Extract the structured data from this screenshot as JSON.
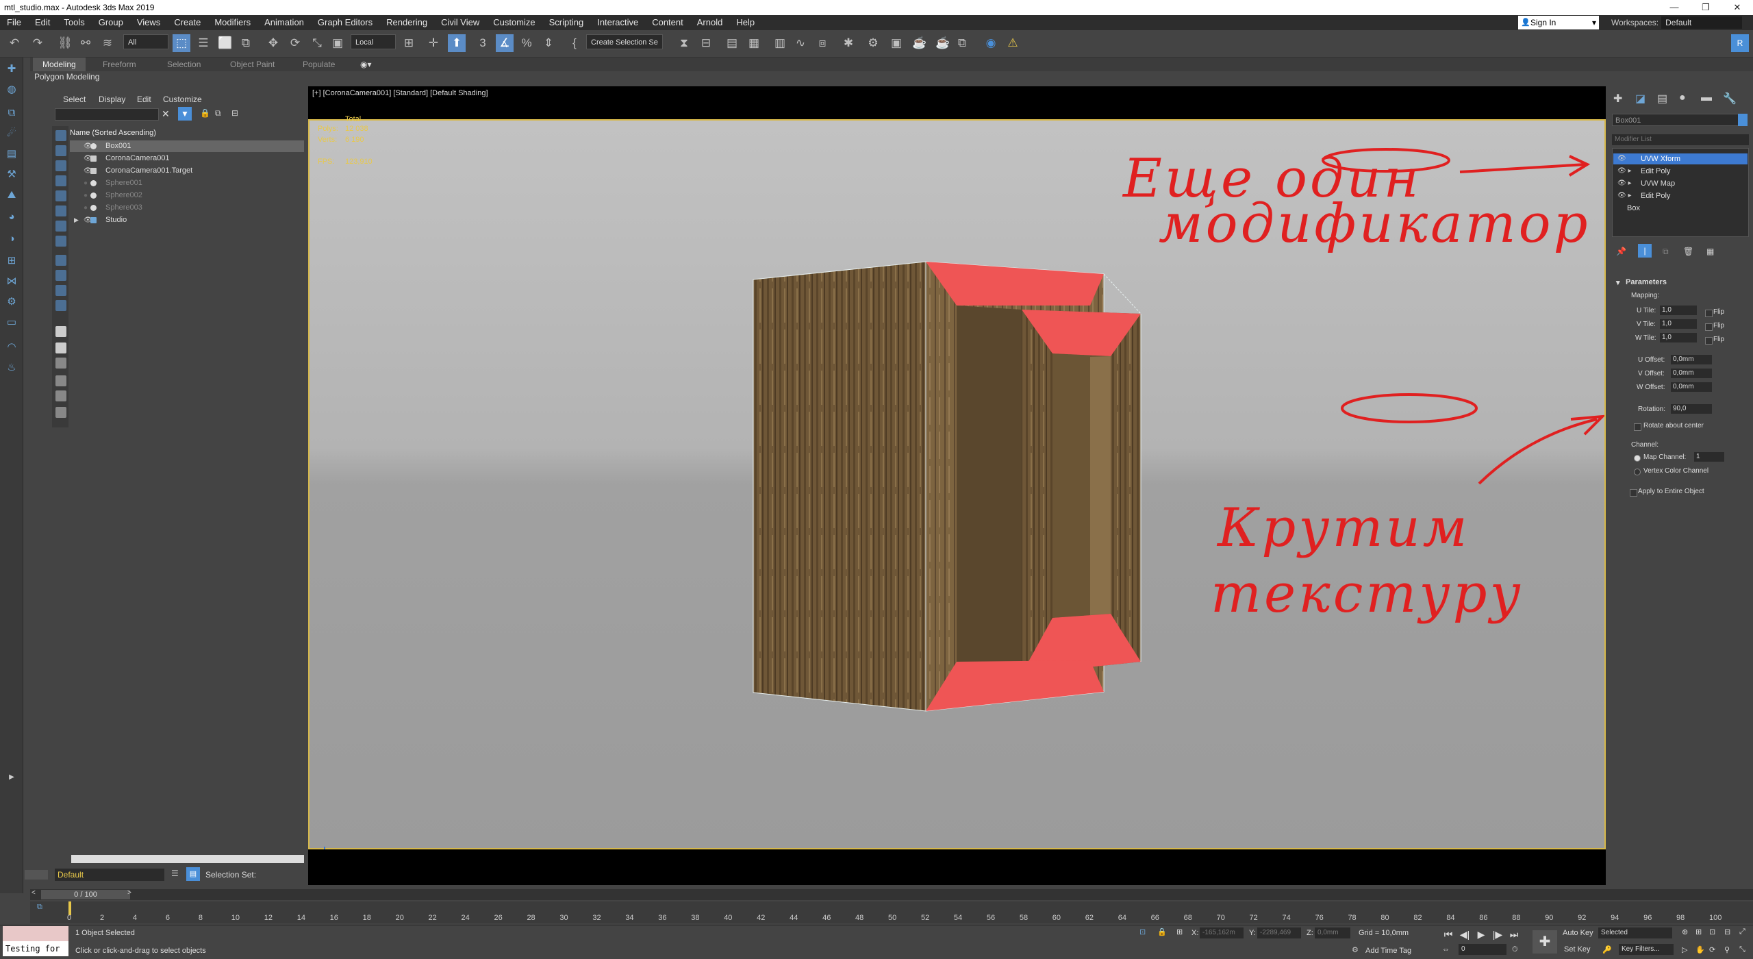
{
  "window": {
    "title": "mtl_studio.max - Autodesk 3ds Max 2019",
    "controls": [
      "—",
      "❐",
      "✕"
    ]
  },
  "menu": [
    "File",
    "Edit",
    "Tools",
    "Group",
    "Views",
    "Create",
    "Modifiers",
    "Animation",
    "Graph Editors",
    "Rendering",
    "Civil View",
    "Customize",
    "Scripting",
    "Interactive",
    "Content",
    "Arnold",
    "Help"
  ],
  "account": {
    "sign_in": "Sign In",
    "workspaces_label": "Workspaces:",
    "workspace": "Default"
  },
  "toolbar": {
    "filter": "All",
    "coord_system": "Local",
    "selection_set": "Create Selection Se",
    "icons": [
      "undo-icon",
      "redo-icon",
      "link-icon",
      "unlink-icon",
      "bind-icon",
      "select-icon",
      "select-by-name-icon",
      "rect-region-icon",
      "window-crossing-icon",
      "move-icon",
      "rotate-icon",
      "scale-icon",
      "pivot-icon",
      "snap-3d-icon",
      "angle-snap-icon",
      "percent-snap-icon",
      "spinner-snap-icon",
      "mirror-icon",
      "align-icon",
      "layers-icon",
      "ribbon-icon",
      "curve-editor-icon",
      "schematic-icon",
      "material-editor-icon",
      "render-setup-icon",
      "render-frame-icon",
      "render-icon"
    ]
  },
  "ribbon": {
    "tabs": [
      "Modeling",
      "Freeform",
      "Selection",
      "Object Paint",
      "Populate"
    ],
    "active": "Modeling",
    "sub": "Polygon Modeling"
  },
  "explorer": {
    "menu": [
      "Select",
      "Display",
      "Edit",
      "Customize"
    ],
    "column": "Name (Sorted Ascending)",
    "rows": [
      {
        "name": "Box001",
        "selected": true,
        "dim": false
      },
      {
        "name": "CoronaCamera001",
        "selected": false,
        "dim": false
      },
      {
        "name": "CoronaCamera001.Target",
        "selected": false,
        "dim": false
      },
      {
        "name": "Sphere001",
        "selected": false,
        "dim": true
      },
      {
        "name": "Sphere002",
        "selected": false,
        "dim": true
      },
      {
        "name": "Sphere003",
        "selected": false,
        "dim": true
      },
      {
        "name": "Studio",
        "selected": false,
        "dim": false
      }
    ],
    "layer": "Default",
    "selection_set_label": "Selection Set:"
  },
  "viewport": {
    "label": "[+] [CoronaCamera001] [Standard] [Default Shading]",
    "stats": {
      "total_label": "Total",
      "polys_label": "Polys:",
      "polys": "12 038",
      "verts_label": "Verts:",
      "verts": "6 190",
      "fps_label": "FPS:",
      "fps": "123,910"
    }
  },
  "annotations": {
    "top": [
      "Еще один",
      "модификатор"
    ],
    "bottom": [
      "Крутим",
      "текстуру"
    ],
    "color": "#e02020"
  },
  "command_panel": {
    "object_name": "Box001",
    "modifier_list": "Modifier List",
    "stack": [
      {
        "label": "UVW Xform",
        "selected": true
      },
      {
        "label": "Edit Poly",
        "selected": false
      },
      {
        "label": "UVW Map",
        "selected": false
      },
      {
        "label": "Edit Poly",
        "selected": false
      },
      {
        "label": "Box",
        "selected": false
      }
    ],
    "params_title": "Parameters",
    "mapping_label": "Mapping:",
    "u_tile_label": "U Tile:",
    "u_tile": "1,0",
    "v_tile_label": "V Tile:",
    "v_tile": "1,0",
    "w_tile_label": "W Tile:",
    "w_tile": "1,0",
    "flip_label": "Flip",
    "u_offset_label": "U Offset:",
    "u_offset": "0,0mm",
    "v_offset_label": "V Offset:",
    "v_offset": "0,0mm",
    "w_offset_label": "W Offset:",
    "w_offset": "0,0mm",
    "rotation_label": "Rotation:",
    "rotation": "90,0",
    "rotate_center": "Rotate about center",
    "channel_label": "Channel:",
    "map_channel_label": "Map Channel:",
    "map_channel": "1",
    "vertex_color": "Vertex Color Channel",
    "apply_entire": "Apply to Entire Object"
  },
  "timeline": {
    "frame": "0 / 100",
    "ticks": [
      "0",
      "2",
      "4",
      "6",
      "8",
      "10",
      "12",
      "14",
      "16",
      "18",
      "20",
      "22",
      "24",
      "26",
      "28",
      "30",
      "32",
      "34",
      "36",
      "38",
      "40",
      "42",
      "44",
      "46",
      "48",
      "50",
      "52",
      "54",
      "56",
      "58",
      "60",
      "62",
      "64",
      "66",
      "68",
      "70",
      "72",
      "74",
      "76",
      "78",
      "80",
      "82",
      "84",
      "86",
      "88",
      "90",
      "92",
      "94",
      "96",
      "98",
      "100"
    ]
  },
  "status": {
    "maxscript": "Testing for",
    "selected": "1 Object Selected",
    "prompt": "Click or click-and-drag to select objects",
    "x_label": "X:",
    "x": "-165,162m",
    "y_label": "Y:",
    "y": "-2289,469",
    "z_label": "Z:",
    "z": "0,0mm",
    "grid": "Grid = 10,0mm",
    "add_time_tag": "Add Time Tag",
    "auto_key": "Auto Key",
    "set_key": "Set Key",
    "key_mode": "Selected",
    "key_filters": "Key Filters...",
    "current_frame": "0"
  }
}
